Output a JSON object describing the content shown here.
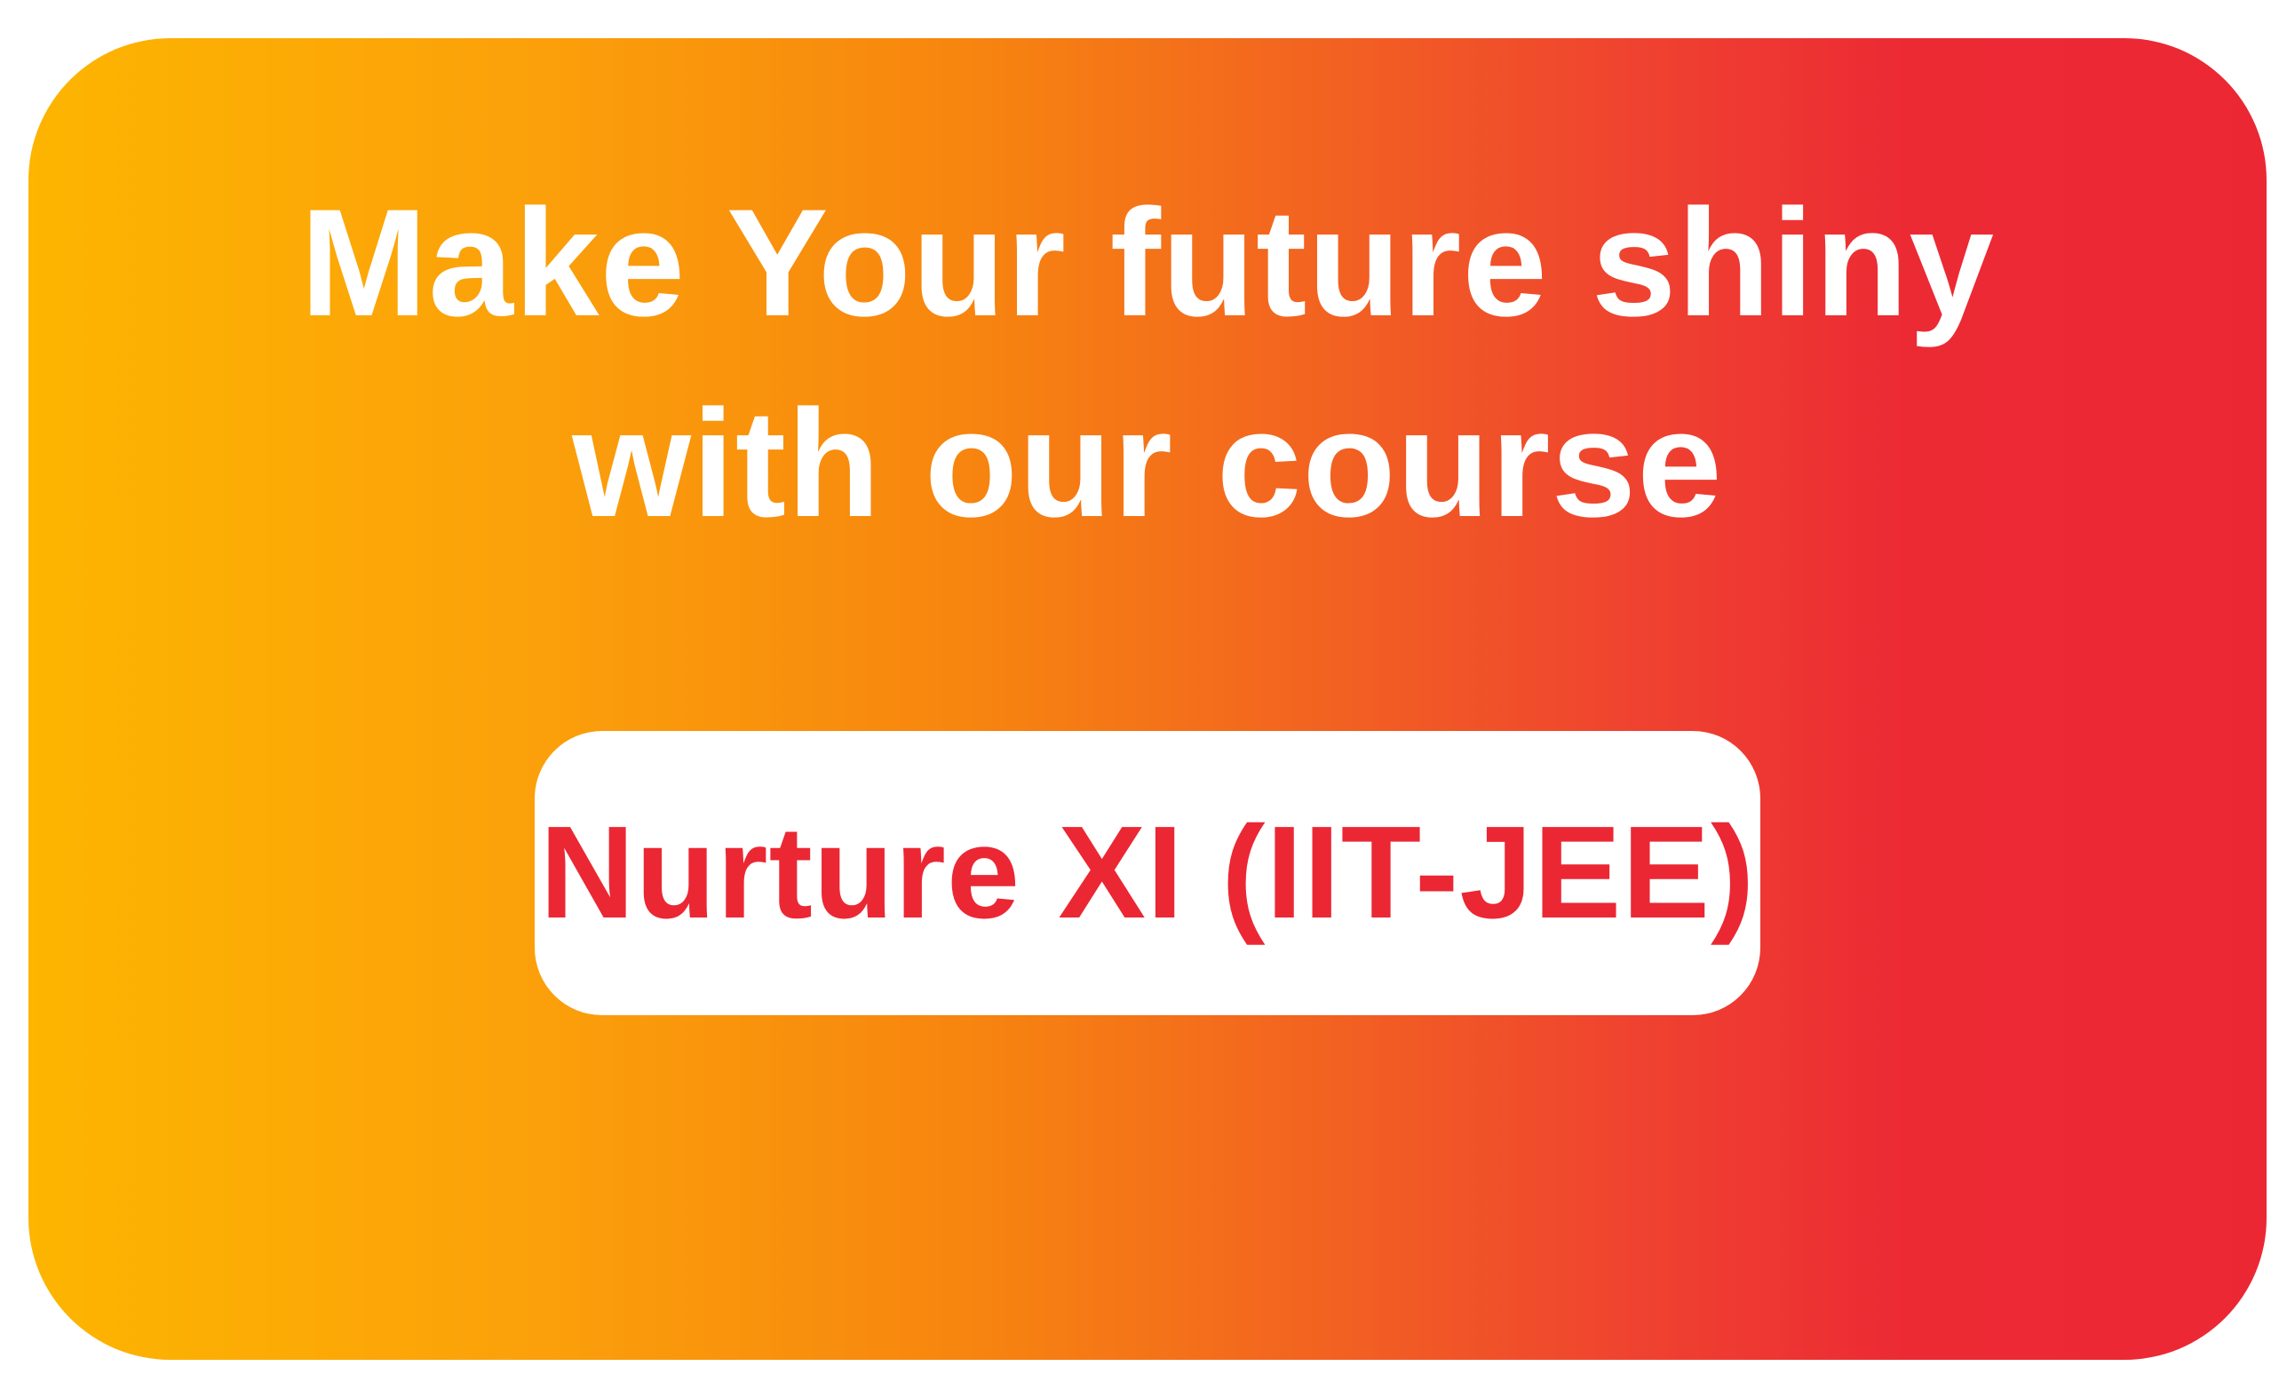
{
  "headline": {
    "line1": "Make Your future shiny",
    "line2": "with our course"
  },
  "course": {
    "label": "Nurture XI (IIT-JEE)"
  },
  "colors": {
    "gradient_start": "#FDB500",
    "gradient_end": "#EB2734",
    "headline_text": "#FFFFFF",
    "course_text": "#EB2734",
    "pill_background": "#FFFFFF"
  }
}
